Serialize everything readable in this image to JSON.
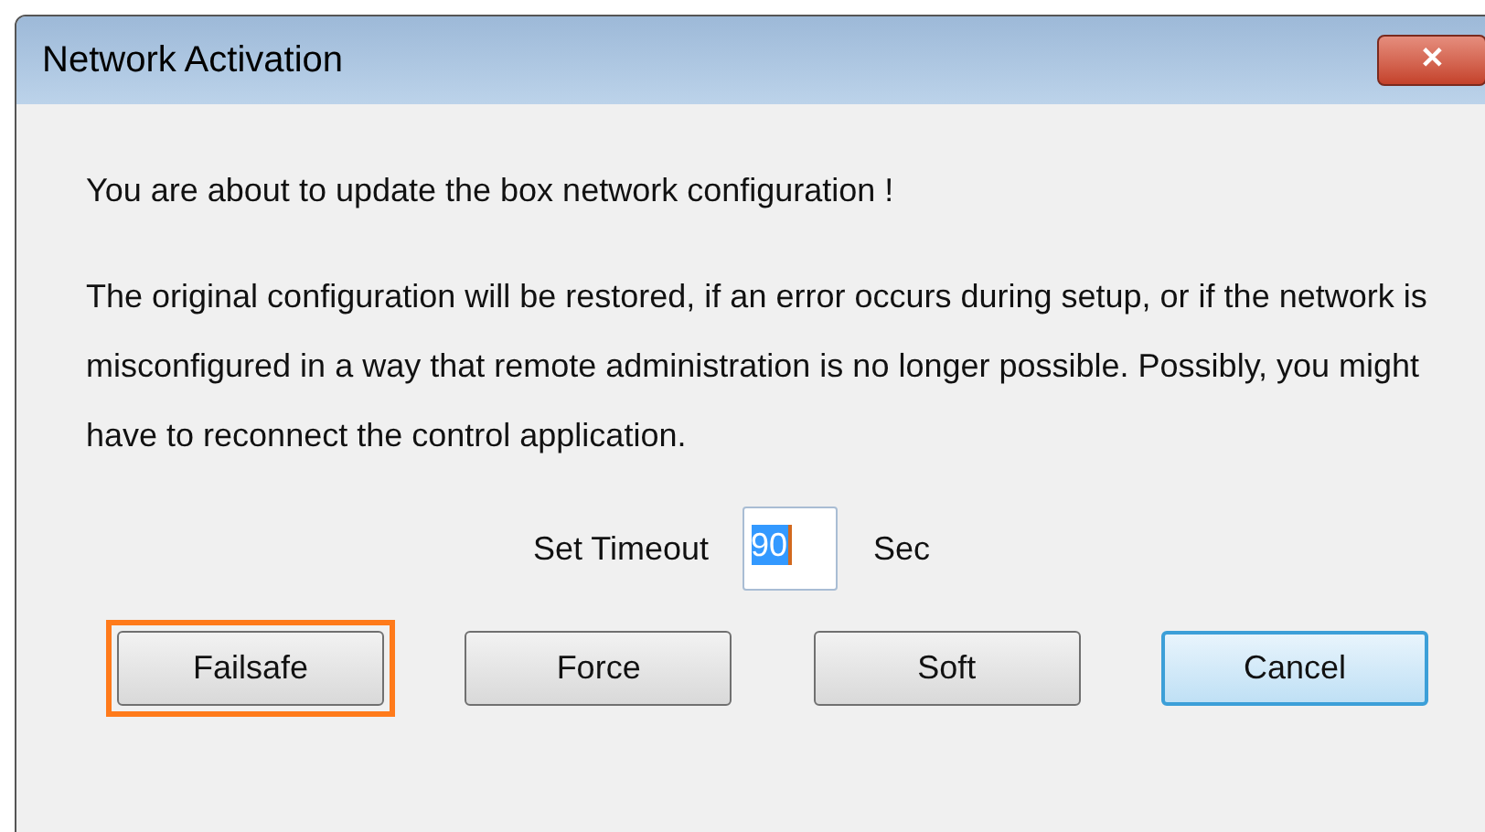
{
  "window": {
    "title": "Network Activation",
    "close_label": "✕"
  },
  "message": "You are about to update the box network configuration !",
  "details": "The original configuration will be restored, if an error occurs during setup, or if the network is misconfigured in a way that remote administration is no longer possible. Possibly, you might have to reconnect the control application.",
  "timeout": {
    "label": "Set Timeout",
    "value": "90",
    "unit": "Sec"
  },
  "buttons": [
    {
      "label": "Failsafe",
      "highlighted": true,
      "default": false
    },
    {
      "label": "Force",
      "highlighted": false,
      "default": false
    },
    {
      "label": "Soft",
      "highlighted": false,
      "default": false
    },
    {
      "label": "Cancel",
      "highlighted": false,
      "default": true
    }
  ]
}
